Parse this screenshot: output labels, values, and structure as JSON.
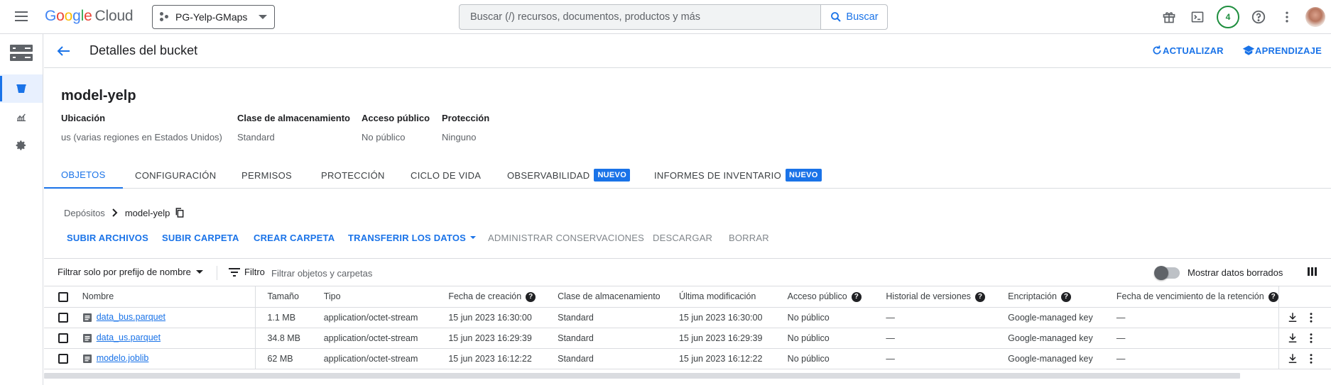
{
  "topbar": {
    "logo_google": "Google",
    "logo_cloud": "Cloud",
    "project": "PG-Yelp-GMaps",
    "search_placeholder": "Buscar (/) recursos, documentos, productos y más",
    "search_button": "Buscar",
    "notifications_count": "4"
  },
  "header": {
    "title": "Detalles del bucket",
    "refresh": "ACTUALIZAR",
    "learn": "APRENDIZAJE"
  },
  "bucket": {
    "name": "model-yelp",
    "meta": [
      {
        "label": "Ubicación",
        "value": "us (varias regiones en Estados Unidos)"
      },
      {
        "label": "Clase de almacenamiento",
        "value": "Standard"
      },
      {
        "label": "Acceso público",
        "value": "No público"
      },
      {
        "label": "Protección",
        "value": "Ninguno"
      }
    ]
  },
  "tabs": [
    {
      "label": "OBJETOS",
      "active": true
    },
    {
      "label": "CONFIGURACIÓN"
    },
    {
      "label": "PERMISOS"
    },
    {
      "label": "PROTECCIÓN"
    },
    {
      "label": "CICLO DE VIDA"
    },
    {
      "label": "OBSERVABILIDAD",
      "badge": "NUEVO"
    },
    {
      "label": "INFORMES DE INVENTARIO",
      "badge": "NUEVO"
    }
  ],
  "breadcrumb": {
    "root": "Depósitos",
    "current": "model-yelp"
  },
  "actions": {
    "upload_files": "SUBIR ARCHIVOS",
    "upload_folder": "SUBIR CARPETA",
    "create_folder": "CREAR CARPETA",
    "transfer": "TRANSFERIR LOS DATOS",
    "manage_holds": "ADMINISTRAR CONSERVACIONES",
    "download": "DESCARGAR",
    "delete": "BORRAR"
  },
  "filterbar": {
    "prefix": "Filtrar solo por prefijo de nombre",
    "filter": "Filtro",
    "placeholder": "Filtrar objetos y carpetas",
    "show_deleted": "Mostrar datos borrados"
  },
  "table": {
    "headers": {
      "name": "Nombre",
      "size": "Tamaño",
      "type": "Tipo",
      "created": "Fecha de creación",
      "class": "Clase de almacenamiento",
      "modified": "Última modificación",
      "public": "Acceso público",
      "versions": "Historial de versiones",
      "encryption": "Encriptación",
      "retention": "Fecha de vencimiento de la retención"
    },
    "rows": [
      {
        "name": "data_bus.parquet",
        "size": "1.1 MB",
        "type": "application/octet-stream",
        "created": "15 jun 2023 16:30:00",
        "class": "Standard",
        "modified": "15 jun 2023 16:30:00",
        "public": "No público",
        "versions": "—",
        "encryption": "Google-managed key",
        "retention": "—"
      },
      {
        "name": "data_us.parquet",
        "size": "34.8 MB",
        "type": "application/octet-stream",
        "created": "15 jun 2023 16:29:39",
        "class": "Standard",
        "modified": "15 jun 2023 16:29:39",
        "public": "No público",
        "versions": "—",
        "encryption": "Google-managed key",
        "retention": "—"
      },
      {
        "name": "modelo.joblib",
        "size": "62 MB",
        "type": "application/octet-stream",
        "created": "15 jun 2023 16:12:22",
        "class": "Standard",
        "modified": "15 jun 2023 16:12:22",
        "public": "No público",
        "versions": "—",
        "encryption": "Google-managed key",
        "retention": "—"
      }
    ]
  }
}
